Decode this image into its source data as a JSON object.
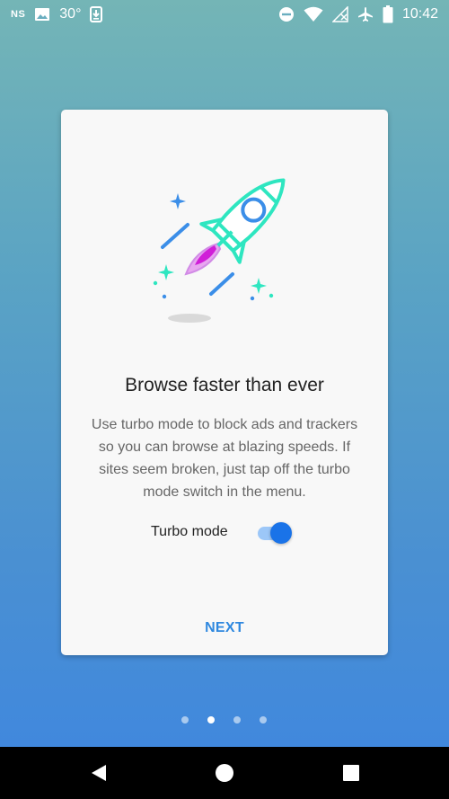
{
  "status_bar": {
    "carrier": "NS",
    "temperature": "30°",
    "time": "10:42",
    "icons": [
      "image-icon",
      "download-icon",
      "do-not-disturb-icon",
      "wifi-icon",
      "no-signal-icon",
      "airplane-mode-icon",
      "battery-icon"
    ]
  },
  "onboarding": {
    "title": "Browse faster than ever",
    "body": "Use turbo mode to block ads and trackers so you can browse at blazing speeds. If sites seem broken, just tap off the turbo mode switch in the menu.",
    "turbo_label": "Turbo mode",
    "turbo_enabled": true,
    "next_label": "NEXT",
    "illustration": "rocket-illustration"
  },
  "pager": {
    "count": 4,
    "active_index": 1
  },
  "nav_bar": {
    "buttons": [
      "back-icon",
      "home-icon",
      "recents-icon"
    ]
  },
  "colors": {
    "accent": "#1a73e8",
    "next_text": "#2f88df",
    "rocket_body": "#2ee6c0",
    "rocket_window": "#3b8ee8",
    "flame": "#d01ed8"
  }
}
